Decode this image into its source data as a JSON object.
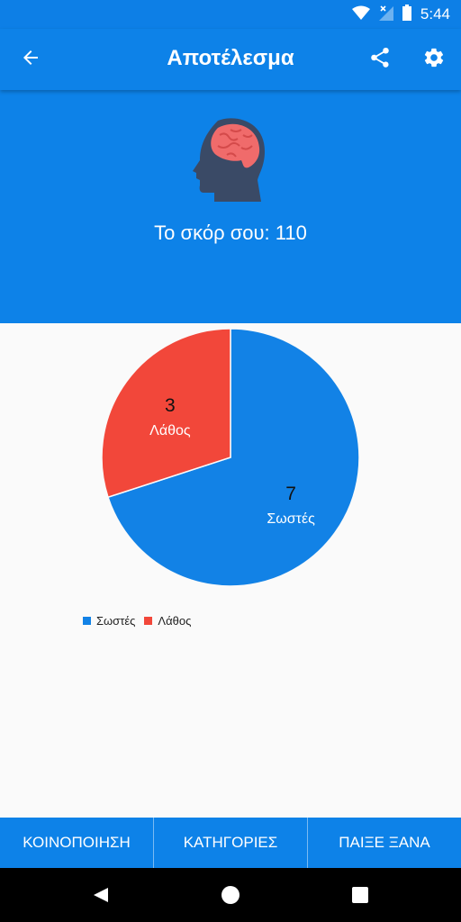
{
  "status_bar": {
    "time": "5:44",
    "icons": [
      "wifi-icon",
      "no-signal-icon",
      "battery-icon"
    ]
  },
  "app_bar": {
    "title": "Αποτέλεσμα",
    "icons": [
      "back-arrow-icon",
      "share-icon",
      "gear-icon"
    ]
  },
  "hero": {
    "icon": "brain-head-icon",
    "score_text": "Το σκόρ σου: 110"
  },
  "colors": {
    "primary": "#0d82e8",
    "correct": "#1282e6",
    "wrong": "#f2473a"
  },
  "chart_data": {
    "type": "pie",
    "slices": [
      {
        "label": "Σωστές",
        "value": 7,
        "color": "#1282e6"
      },
      {
        "label": "Λάθος",
        "value": 3,
        "color": "#f2473a"
      }
    ],
    "legend": [
      "Σωστές",
      "Λάθος"
    ],
    "legend_position": "bottom-left"
  },
  "bottom_bar": {
    "buttons": [
      "ΚΟΙΝΟΠΟΙΗΣΗ",
      "ΚΑΤΗΓΟΡΙΕΣ",
      "ΠΑΙΞΕ ΞΑΝΑ"
    ]
  },
  "nav_bar": {
    "icons": [
      "back-triangle-icon",
      "home-circle-icon",
      "recents-square-icon"
    ]
  }
}
